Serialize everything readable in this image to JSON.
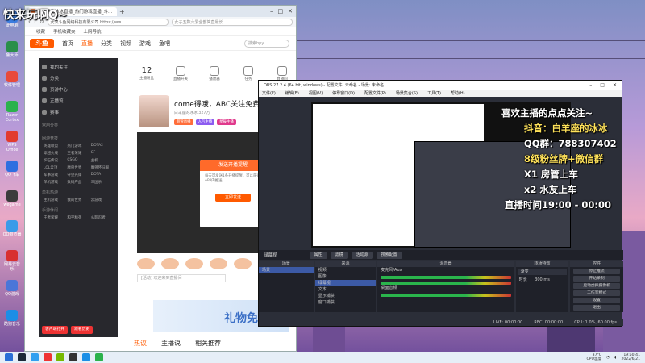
{
  "overlay": {
    "title": "快来玩啊Q~",
    "lines": [
      {
        "text": "喜欢主播的点点关注~",
        "color": "#ffffff"
      },
      {
        "text": "抖音：白羊座的冰冰",
        "color": "#ffe25a"
      },
      {
        "text": "QQ群：788307402",
        "color": "#ffffff"
      },
      {
        "text": "8级粉丝牌+微信群",
        "color": "#ffe25a"
      },
      {
        "text": "X1 房管上车",
        "color": "#ffffff"
      },
      {
        "text": "x2 水友上车",
        "color": "#ffffff"
      },
      {
        "text": "直播时间19:00 - 00:00",
        "color": "#ffffff"
      }
    ]
  },
  "desktop": {
    "icons": [
      {
        "label": "此电脑",
        "color": "#3b7de0"
      },
      {
        "label": "鲁大师",
        "color": "#2a8f4a"
      },
      {
        "label": "软件管理",
        "color": "#e84a3a"
      },
      {
        "label": "Razer Cortex",
        "color": "#2bb24c"
      },
      {
        "label": "WPS Office",
        "color": "#e23b2e"
      },
      {
        "label": "QQ飞车",
        "color": "#2f6fe0"
      },
      {
        "label": "wegame",
        "color": "#3c3c3c"
      },
      {
        "label": "QQ浏览器",
        "color": "#3a9be8"
      },
      {
        "label": "网易云音乐",
        "color": "#d8302f"
      },
      {
        "label": "QQ游戏",
        "color": "#4a76d8"
      },
      {
        "label": "酷狗音乐",
        "color": "#1c8ee6"
      }
    ]
  },
  "browser": {
    "tab_title": "白羊座的冰冰直播_热门游戏直播_斗...",
    "url": "武汉斗鱼网络科技有限公司  https://ww",
    "search_placeholder": "女子五数六爱全部简直最长",
    "bookmarks": [
      "收藏",
      "手机收藏夹",
      "上网导航"
    ],
    "site": {
      "logo": "斗鱼",
      "nav": [
        "首页",
        "直播",
        "分类",
        "视频",
        "游戏",
        "鱼吧"
      ],
      "nav_active": 1,
      "search_placeholder": "搜索bpy"
    },
    "sidebar": {
      "top_items": [
        "我的关注",
        "分类",
        "页游中心",
        "正播流",
        "赛事"
      ],
      "sec1_title": "常用分类",
      "sec2_title": "网游竞技",
      "sec2_items": [
        "英雄联盟",
        "热门游戏",
        "DOTA2",
        "穿越火线",
        "王者荣耀",
        "CF",
        "炉石传说",
        "CSGO",
        "主机",
        "LOL云顶",
        "魔兽世界",
        "魔兽怀旧服",
        "军事游戏",
        "守望先锋",
        "DOTA",
        "单机游戏",
        "数码产品",
        "三国杀"
      ],
      "sec3_title": "单机热游",
      "sec3_items": [
        "主机游戏",
        "我的世界",
        "云游戏"
      ],
      "sec4_title": "手游休闲",
      "sec4_items": [
        "王者荣耀",
        "和平精英",
        "火影忍者"
      ],
      "btns": [
        "客户端打开",
        "观看历史"
      ]
    },
    "stats": [
      {
        "value": "12",
        "label": "主播粉丝"
      },
      {
        "value": "",
        "label": "直播开关"
      },
      {
        "value": "",
        "label": "播放器"
      },
      {
        "value": "",
        "label": "任务"
      },
      {
        "value": "",
        "label": "直播间"
      }
    ],
    "room": {
      "title": "come得哦，ABC关注免费",
      "sub": "白羊座的冰冰   327万",
      "tags": [
        "超管直播",
        "人气主播",
        "星辰主播"
      ]
    },
    "popup": {
      "header": "发送开播提醒",
      "text": "每天可发送1条开播提醒，可以获得APP内推送",
      "button": "立即发送"
    },
    "chat_placeholder": "[活动] 欢迎来到直播间",
    "banner_text": "礼物免费",
    "bottom_tabs": [
      "热议",
      "主播说",
      "相关推荐"
    ]
  },
  "obs": {
    "title": "OBS 27.2.4 (64 bit, windows) - 配置文件: 未命名 - 场景: 未命名",
    "menu": [
      "文件(F)",
      "编辑(E)",
      "视图(V)",
      "停靠窗口(D)",
      "配置文件(P)",
      "场景集合(S)",
      "工具(T)",
      "帮助(H)"
    ],
    "scene_bar_label": "绿幕视",
    "scene_bar_btns": [
      "属性",
      "滤镜",
      "活动源",
      "搜索配置"
    ],
    "docks": {
      "scenes": {
        "title": "场景",
        "items": [
          "场景"
        ]
      },
      "sources": {
        "title": "来源",
        "items": [
          "视频",
          "图像",
          "绿幕视",
          "文本",
          "显示捕获",
          "窗口捕获"
        ]
      },
      "mixer": {
        "title": "混音器",
        "channels": [
          "麦克风/Aux",
          "桌面音频"
        ]
      },
      "transitions": {
        "title": "转场特效",
        "type": "渐变",
        "duration_label": "时长",
        "duration": "300 ms"
      },
      "controls": {
        "title": "控件",
        "items": [
          "停止推流",
          "开始录制",
          "启动虚拟摄像机",
          "工作室模式",
          "设置",
          "退出"
        ]
      }
    },
    "status": [
      "LIVE: 00:00:00",
      "REC: 00:00:00",
      "CPU: 1.0%, 60.00 fps"
    ]
  },
  "taskbar": {
    "temp": "37°C",
    "cpu": "CPU温度",
    "time": "19:50:41",
    "date": "2022/6/21"
  }
}
